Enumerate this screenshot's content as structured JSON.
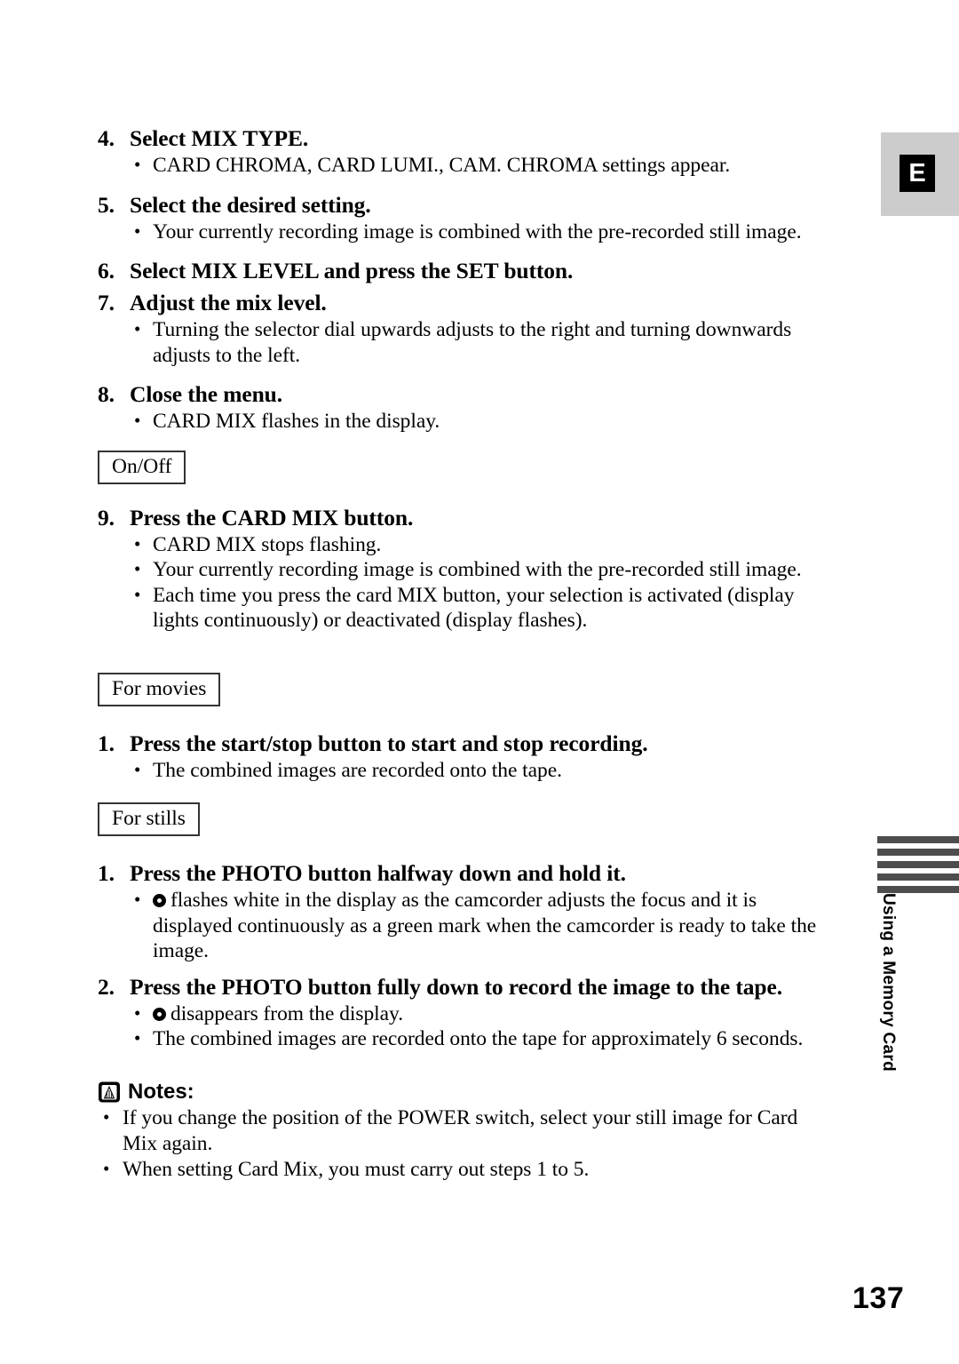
{
  "badge": {
    "language_letter": "E"
  },
  "side_tab": {
    "label": "Using a Memory Card",
    "bar_count": 5,
    "bar_color": "#4d4d4d"
  },
  "page": {
    "number": "137"
  },
  "steps": [
    {
      "number": "4.",
      "title": "Select MIX TYPE.",
      "bullets": [
        "CARD CHROMA, CARD LUMI., CAM. CHROMA settings appear."
      ]
    },
    {
      "number": "5.",
      "title": "Select the desired setting.",
      "bullets": [
        "Your currently recording image is combined with the pre-recorded still image."
      ]
    },
    {
      "number": "6.",
      "title": "Select MIX LEVEL and press the SET button.",
      "bullets": []
    },
    {
      "number": "7.",
      "title": "Adjust the mix level.",
      "bullets": [
        "Turning the selector dial upwards adjusts to the right and turning downwards adjusts to the left."
      ]
    },
    {
      "number": "8.",
      "title": "Close the menu.",
      "bullets": [
        "CARD MIX flashes in the display."
      ]
    }
  ],
  "onoff_section": {
    "tag": "On/Off",
    "step": {
      "number": "9.",
      "title": "Press the CARD MIX button.",
      "bullets": [
        "CARD MIX stops flashing.",
        "Your currently recording image is combined with the pre-recorded still image.",
        "Each time you press the card MIX button, your selection is activated (display lights continuously) or deactivated (display flashes)."
      ]
    }
  },
  "movies_section": {
    "tag": "For movies",
    "step": {
      "number": "1.",
      "title": "Press the start/stop button to start and stop recording.",
      "bullets": [
        "The combined images are recorded onto the tape."
      ]
    }
  },
  "stills_section": {
    "tag": "For stills",
    "steps": [
      {
        "number": "1.",
        "title": "Press the PHOTO button halfway down and hold it.",
        "bullet_with_glyph": "flashes white in the display as the camcorder adjusts the focus and it is displayed continuously as a green mark when the camcorder is ready to take the image."
      },
      {
        "number": "2.",
        "title": "Press the PHOTO button fully down to record the image to the tape.",
        "bullet_with_glyph": "disappears from the display.",
        "bullets": [
          "The combined images are recorded onto the tape for approximately 6 seconds."
        ]
      }
    ]
  },
  "notes": {
    "heading": "Notes:",
    "items": [
      "If you change the position of the POWER switch, select your still image for Card Mix again.",
      "When setting Card Mix, you must carry out steps 1 to 5."
    ]
  }
}
